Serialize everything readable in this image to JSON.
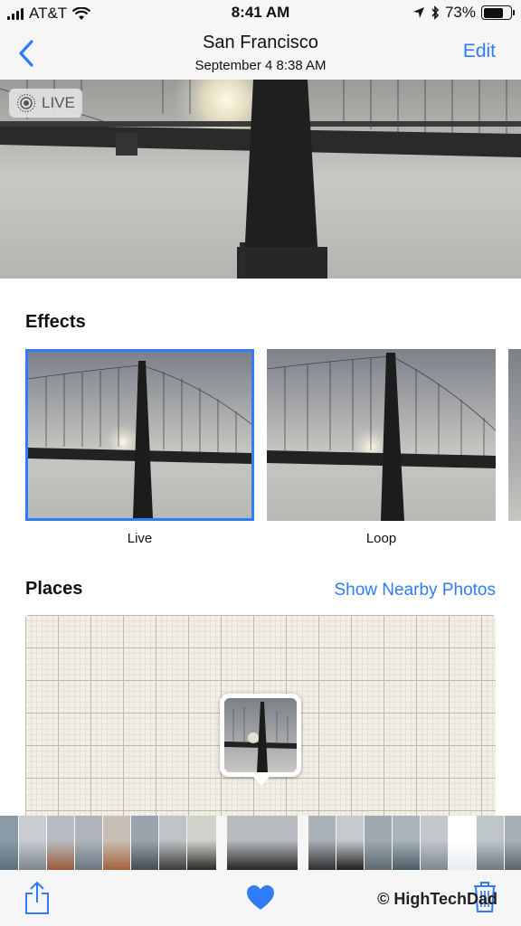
{
  "status_bar": {
    "carrier": "AT&T",
    "time": "8:41 AM",
    "battery_percent": "73%",
    "battery_level": 0.73
  },
  "nav": {
    "back_icon": "chevron-left-icon",
    "title": "San Francisco",
    "subtitle": "September 4  8:38 AM",
    "edit_label": "Edit"
  },
  "hero": {
    "live_label": "LIVE",
    "live_icon": "live-photo-icon"
  },
  "effects": {
    "title": "Effects",
    "items": [
      {
        "label": "Live",
        "selected": true
      },
      {
        "label": "Loop",
        "selected": false
      }
    ]
  },
  "places": {
    "title": "Places",
    "action_label": "Show Nearby Photos"
  },
  "toolbar": {
    "share_icon": "share-icon",
    "favorite_icon": "heart-icon",
    "delete_icon": "trash-icon",
    "watermark": "© HighTechDad"
  },
  "colors": {
    "accent": "#2f7cf6",
    "bar_background": "#f6f6f6",
    "map_background": "#f2efe6"
  }
}
